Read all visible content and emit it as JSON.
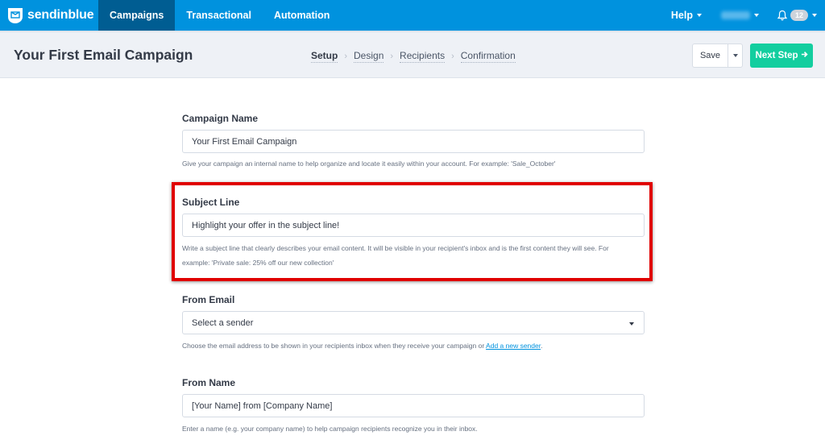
{
  "brand": {
    "name": "sendinblue",
    "logo_icon": "envelope-shield-icon"
  },
  "topnav": {
    "items": [
      {
        "label": "Campaigns",
        "active": true
      },
      {
        "label": "Transactional",
        "active": false
      },
      {
        "label": "Automation",
        "active": false
      }
    ],
    "help_label": "Help",
    "account_name_redacted": true,
    "notifications": {
      "icon": "bell-icon",
      "count": "12"
    }
  },
  "subheader": {
    "title": "Your First Email Campaign",
    "steps": [
      {
        "label": "Setup",
        "active": true
      },
      {
        "label": "Design",
        "active": false
      },
      {
        "label": "Recipients",
        "active": false
      },
      {
        "label": "Confirmation",
        "active": false
      }
    ],
    "save_label": "Save",
    "next_label": "Next Step",
    "next_icon": "arrow-right-icon"
  },
  "form": {
    "campaign_name": {
      "label": "Campaign Name",
      "value": "Your First Email Campaign",
      "help": "Give your campaign an internal name to help organize and locate it easily within your account. For example: 'Sale_October'"
    },
    "subject_line": {
      "label": "Subject Line",
      "value": "Highlight your offer in the subject line!",
      "help_line1": "Write a subject line that clearly describes your email content. It will be visible in your recipient's inbox and is the first content they will see. For",
      "help_line2": "example: 'Private sale: 25% off our new collection'",
      "highlighted": true
    },
    "from_email": {
      "label": "From Email",
      "value": "Select a sender",
      "help": "Choose the email address to be shown in your recipients inbox when they receive your campaign or ",
      "help_link": "Add a new sender",
      "help_suffix": "."
    },
    "from_name": {
      "label": "From Name",
      "value": "[Your Name] from [Company Name]",
      "help": "Enter a name (e.g. your company name) to help campaign recipients recognize you in their inbox."
    }
  },
  "colors": {
    "nav_bg": "#0092de",
    "nav_active": "#005d92",
    "primary_button": "#13ce9f",
    "highlight_border": "#e00000",
    "link": "#0092de"
  }
}
